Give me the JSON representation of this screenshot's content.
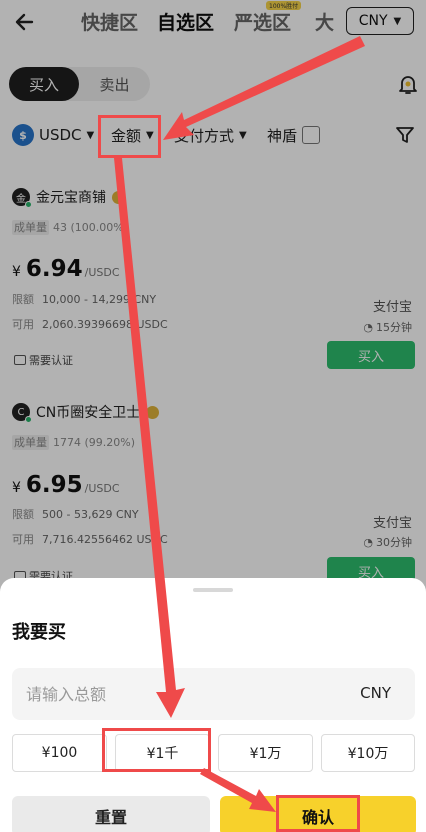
{
  "header": {
    "tabs": [
      {
        "label": "快捷区"
      },
      {
        "label": "自选区"
      },
      {
        "label": "严选区"
      },
      {
        "label": "大"
      }
    ],
    "tab_badge": "100%胜付",
    "currency": "CNY"
  },
  "trade_toggle": {
    "buy": "买入",
    "sell": "卖出"
  },
  "filters": {
    "coin": "USDC",
    "coin_icon_text": "$",
    "amount": "金额",
    "payment": "支付方式",
    "shield": "神盾"
  },
  "offers": [
    {
      "avatar_letter": "金",
      "merchant": "金元宝商铺",
      "stats_label": "成单量",
      "stats_value": "43 (100.00%)",
      "currency_symbol": "¥",
      "price": "6.94",
      "unit": "/USDC",
      "limit_label": "限额",
      "limit": "10,000 - 14,299 CNY",
      "available_label": "可用",
      "available": "2,060.39396698 USDC",
      "pay_method": "支付宝",
      "time": "15分钟",
      "buy": "买入",
      "verify": "需要认证"
    },
    {
      "avatar_letter": "C",
      "merchant": "CN币圈安全卫士",
      "stats_label": "成单量",
      "stats_value": "1774 (99.20%)",
      "currency_symbol": "¥",
      "price": "6.95",
      "unit": "/USDC",
      "limit_label": "限额",
      "limit": "500 - 53,629 CNY",
      "available_label": "可用",
      "available": "7,716.42556462 USDC",
      "pay_method": "支付宝",
      "time": "30分钟",
      "buy": "买入",
      "verify": "需要认证"
    }
  ],
  "sheet": {
    "title": "我要买",
    "amount_placeholder": "请输入总额",
    "amount_unit": "CNY",
    "presets": [
      "¥100",
      "¥1千",
      "¥1万",
      "¥10万"
    ],
    "reset": "重置",
    "confirm": "确认"
  },
  "colors": {
    "annotation": "#ef4a4a",
    "buy_green": "#2dbd6e",
    "confirm_yellow": "#f7d12b"
  }
}
